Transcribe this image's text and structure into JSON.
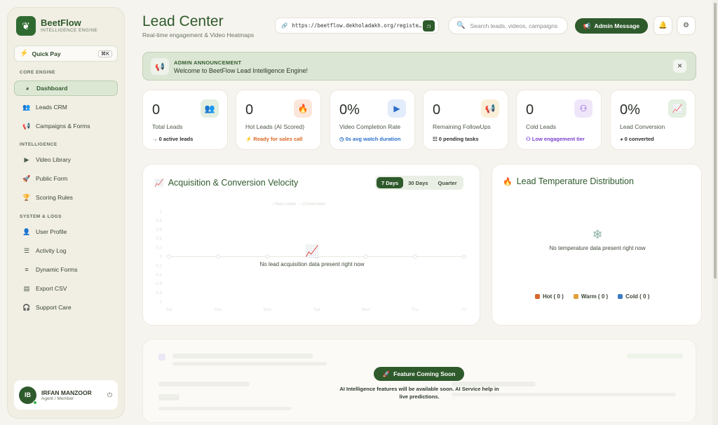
{
  "brand": {
    "name": "BeetFlow",
    "subtitle": "INTELLIGENCE ENGINE",
    "logo_icon": "leaf-icon"
  },
  "quick_pay": {
    "label": "Quick Pay",
    "shortcut": "⌘K"
  },
  "sidebar": {
    "sections": [
      {
        "title": "CORE ENGINE",
        "items": [
          {
            "label": "Dashboard",
            "icon": "pie-chart-icon",
            "active": true
          },
          {
            "label": "Leads CRM",
            "icon": "users-icon"
          },
          {
            "label": "Campaigns & Forms",
            "icon": "megaphone-icon"
          }
        ]
      },
      {
        "title": "INTELLIGENCE",
        "items": [
          {
            "label": "Video Library",
            "icon": "play-circle-icon"
          },
          {
            "label": "Public Form",
            "icon": "rocket-icon"
          },
          {
            "label": "Scoring Rules",
            "icon": "trophy-icon"
          }
        ]
      },
      {
        "title": "SYSTEM & LOGS",
        "items": [
          {
            "label": "User Profile",
            "icon": "user-gear-icon"
          },
          {
            "label": "Activity Log",
            "icon": "list-check-icon"
          },
          {
            "label": "Dynamic Forms",
            "icon": "sliders-icon"
          },
          {
            "label": "Export CSV",
            "icon": "file-csv-icon"
          },
          {
            "label": "Support Care",
            "icon": "headset-icon"
          }
        ]
      }
    ]
  },
  "user": {
    "initials": "IB",
    "name": "IRFAN MANZOOR",
    "role": "Agent / Member"
  },
  "header": {
    "title": "Lead Center",
    "subtitle": "Real-time engagement & Video Heatmaps",
    "url": "https://beetflow.dekholadakh.org/registe…",
    "search_placeholder": "Search leads, videos, campaigns",
    "admin_button": "Admin Message"
  },
  "announcement": {
    "label": "ADMIN ANNOUNCEMENT",
    "message": "Welcome to BeetFlow Lead Intelligence Engine!"
  },
  "stats": [
    {
      "value": "0",
      "label": "Total Leads",
      "sub": "→ 0 active leads",
      "icon": "users-icon",
      "icon_color": "#2f6b31",
      "icon_bg": "#e3efe0",
      "sub_color": "#2a2f28"
    },
    {
      "value": "0",
      "label": "Hot Leads (AI Scored)",
      "sub": "⚡ Ready for sales call",
      "icon": "fire-icon",
      "icon_color": "#e2552a",
      "icon_bg": "#fbe6dc",
      "sub_color": "#d9661f"
    },
    {
      "value": "0%",
      "label": "Video Completion Rate",
      "sub": "◷ 0s avg watch duration",
      "icon": "play-icon",
      "icon_color": "#2b6fc9",
      "icon_bg": "#e2ecfa",
      "sub_color": "#2b6fc9"
    },
    {
      "value": "0",
      "label": "Remaining FollowUps",
      "sub": "☷ 0 pending tasks",
      "icon": "megaphone-icon",
      "icon_color": "#d08b14",
      "icon_bg": "#fbefd8",
      "sub_color": "#2a2f28"
    },
    {
      "value": "0",
      "label": "Cold Leads",
      "sub": "⚇ Low engagement tier",
      "icon": "network-icon",
      "icon_color": "#7a3fd0",
      "icon_bg": "#efe6fa",
      "sub_color": "#7a3fd0"
    },
    {
      "value": "0%",
      "label": "Lead Conversion",
      "sub": "◕ 0 converted",
      "icon": "trend-chart-icon",
      "icon_color": "#2f6b31",
      "icon_bg": "#e3efe0",
      "sub_color": "#2a2f28"
    }
  ],
  "velocity": {
    "title": "Acquisition & Conversion Velocity",
    "ranges": [
      "7 Days",
      "30 Days",
      "Quarter"
    ],
    "active_range": "7 Days",
    "empty_text": "No lead acquisition data present right now",
    "legend": [
      "New Leads",
      "Conversions"
    ],
    "y_ticks": [
      "1",
      "0.8",
      "0.6",
      "0.4",
      "0.2",
      "0",
      "-0.2",
      "-0.4",
      "-0.6",
      "-0.8",
      "-1"
    ],
    "x_ticks": [
      "Sat",
      "Sun",
      "Mon",
      "Tue",
      "Wed",
      "Thu",
      "Fri"
    ]
  },
  "temperature": {
    "title": "Lead Temperature Distribution",
    "empty_text": "No temperature data present right now",
    "legend": [
      {
        "label": "Hot ( 0 )",
        "color": "#d9662a"
      },
      {
        "label": "Warm ( 0 )",
        "color": "#e0a03a"
      },
      {
        "label": "Cold ( 0 )",
        "color": "#3e7bc4"
      }
    ]
  },
  "coming_soon": {
    "pill": "Feature Coming Soon",
    "text": "AI Intelligence features will be available soon. AI Service help in live predictions."
  }
}
